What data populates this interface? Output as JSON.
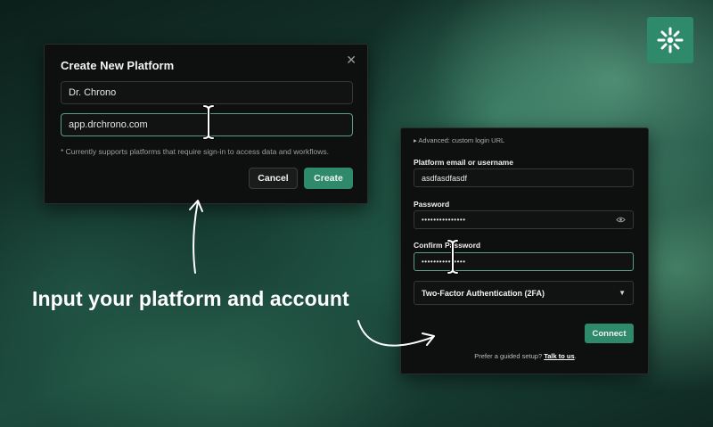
{
  "left_dialog": {
    "title": "Create New Platform",
    "close_symbol": "✕",
    "name_value": "Dr. Chrono",
    "url_value": "app.drchrono.com",
    "note": "* Currently supports platforms that require sign-in to access data and workflows.",
    "cancel_label": "Cancel",
    "create_label": "Create"
  },
  "right_dialog": {
    "advanced_link": "▸ Advanced: custom login URL",
    "email_label": "Platform email or username",
    "email_value": "asdfasdfasdf",
    "password_label": "Password",
    "password_value": "•••••••••••••••",
    "confirm_label": "Confirm Password",
    "confirm_value": "•••••••••••••••",
    "mfa_value": "Two-Factor Authentication (2FA)",
    "mfa_arrow": "▼",
    "connect_label": "Connect",
    "guided_prefix": "Prefer a guided setup? ",
    "guided_link": "Talk to us",
    "guided_suffix": "."
  },
  "caption": "Input your platform and account",
  "icons": {
    "logo": "sunburst-logo-icon",
    "cursor": "text-cursor-icon",
    "eye": "eye-icon",
    "arrows": "hand-drawn-arrow-icon"
  },
  "colors": {
    "accent": "#2f8a6b",
    "dialog_bg": "#0e0f0f",
    "focus_border": "#5a9b84"
  }
}
